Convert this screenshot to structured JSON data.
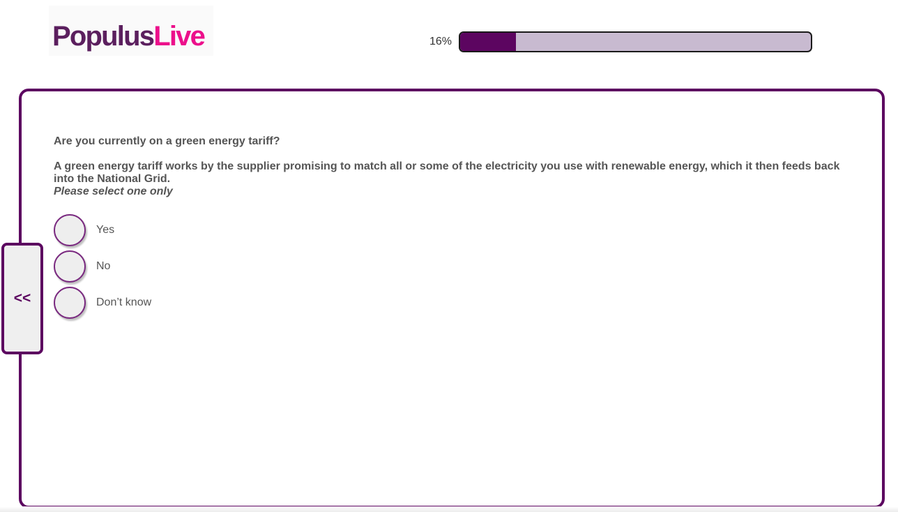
{
  "logo": {
    "part1": "Populus",
    "part2": "Live"
  },
  "progress": {
    "label": "16%",
    "value": 0.16
  },
  "question": {
    "title": "Are you currently on a green energy tariff?",
    "description": "A green energy tariff works by the supplier promising to match all or some of the electricity you use with renewable energy, which it then feeds back into the National Grid.",
    "instruction": "Please select one only"
  },
  "options": [
    {
      "label": "Yes"
    },
    {
      "label": "No"
    },
    {
      "label": "Don’t know"
    }
  ],
  "nav": {
    "back_label": "<<"
  },
  "colors": {
    "brand_purple": "#5c0560",
    "brand_pink": "#ec0f8b",
    "progress_track": "#c8bad0",
    "text_gray": "#555555"
  }
}
